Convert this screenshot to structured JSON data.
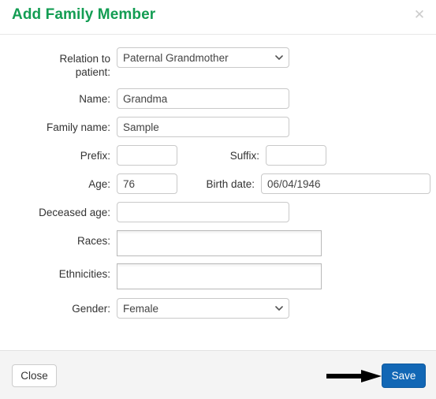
{
  "modal": {
    "title": "Add Family Member",
    "close_icon": "close-icon",
    "title_color": "#139d53"
  },
  "form": {
    "relation": {
      "label": "Relation to patient:",
      "label_line1": "Relation to",
      "label_line2": "patient:",
      "value": "Paternal Grandmother",
      "options": [
        "Paternal Grandmother"
      ]
    },
    "name": {
      "label": "Name:",
      "value": "Grandma",
      "placeholder": ""
    },
    "family_name": {
      "label": "Family name:",
      "value": "Sample",
      "placeholder": ""
    },
    "prefix": {
      "label": "Prefix:",
      "value": "",
      "placeholder": ""
    },
    "suffix": {
      "label": "Suffix:",
      "value": "",
      "placeholder": ""
    },
    "age": {
      "label": "Age:",
      "value": "76",
      "placeholder": ""
    },
    "birth_date": {
      "label": "Birth date:",
      "value": "06/04/1946",
      "placeholder": ""
    },
    "deceased_age": {
      "label": "Deceased age:",
      "value": "",
      "placeholder": ""
    },
    "races": {
      "label": "Races:",
      "value": "",
      "placeholder": ""
    },
    "ethnicities": {
      "label": "Ethnicities:",
      "value": "",
      "placeholder": ""
    },
    "gender": {
      "label": "Gender:",
      "value": "Female",
      "options": [
        "Female"
      ]
    }
  },
  "footer": {
    "close_label": "Close",
    "save_label": "Save",
    "save_color": "#1267b5",
    "annotation": "arrow-pointing-to-save"
  }
}
